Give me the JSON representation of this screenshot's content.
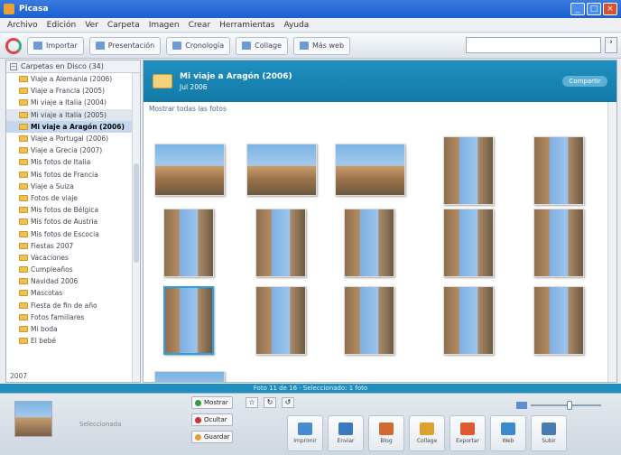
{
  "window": {
    "title": "Picasa"
  },
  "menu": [
    "Archivo",
    "Edición",
    "Ver",
    "Carpeta",
    "Imagen",
    "Crear",
    "Herramientas",
    "Ayuda"
  ],
  "toolbar": {
    "buttons": [
      {
        "label": "Importar",
        "icon": "import-icon"
      },
      {
        "label": "Presentación",
        "icon": "slideshow-icon"
      },
      {
        "label": "Cronología",
        "icon": "timeline-icon"
      },
      {
        "label": "Collage",
        "icon": "collage-icon"
      },
      {
        "label": "Más web",
        "icon": "web-icon"
      }
    ],
    "search_placeholder": "",
    "search_go": "›"
  },
  "sidebar": {
    "header": "Carpetas en Disco (34)",
    "items": [
      "Viaje a Alemania (2006)",
      "Viaje a Francia (2005)",
      "Mi viaje a Italia (2004)",
      "Mi viaje a Italia (2005)",
      "Mi viaje a Aragón (2006)",
      "Viaje a Portugal (2006)",
      "Viaje a Grecia (2007)",
      "Mis fotos de Italia",
      "Mis fotos de Francia",
      "Viaje a Suiza",
      "Fotos de viaje",
      "Mis fotos de Bélgica",
      "Mis fotos de Austria",
      "Mis fotos de Escocia",
      "Fiestas 2007",
      "Vacaciones",
      "Cumpleaños",
      "Navidad 2006",
      "Mascotas",
      "Fiesta de fin de año",
      "Fotos familiares",
      "Mi boda",
      "El bebé"
    ],
    "selected_index": 4,
    "footer": "2007"
  },
  "album": {
    "title": "Mi viaje a Aragón (2006)",
    "date": "Jul 2006",
    "header_button": "Compartir",
    "filter_text": "Mostrar todas las fotos",
    "photos": [
      {
        "name": "photo-01",
        "orient": "wide"
      },
      {
        "name": "photo-02",
        "orient": "wide"
      },
      {
        "name": "photo-03",
        "orient": "wide"
      },
      {
        "name": "photo-04",
        "orient": "tall"
      },
      {
        "name": "photo-05",
        "orient": "tall"
      },
      {
        "name": "photo-06",
        "orient": "tall"
      },
      {
        "name": "photo-07",
        "orient": "tall"
      },
      {
        "name": "photo-08",
        "orient": "tall"
      },
      {
        "name": "photo-09",
        "orient": "tall"
      },
      {
        "name": "photo-10",
        "orient": "tall"
      },
      {
        "name": "photo-11",
        "orient": "tall"
      },
      {
        "name": "photo-12",
        "orient": "tall"
      },
      {
        "name": "photo-13",
        "orient": "tall"
      },
      {
        "name": "photo-14",
        "orient": "tall"
      },
      {
        "name": "photo-15",
        "orient": "tall"
      },
      {
        "name": "photo-16",
        "orient": "wide"
      }
    ],
    "selected_photo": 10
  },
  "status_text": "Foto 11 de 16 · Seleccionado: 1 foto",
  "tray": {
    "caption": "Seleccionada",
    "buttons": [
      "Mostrar",
      "Ocultar",
      "Guardar"
    ],
    "tools": [
      "☆",
      "↻",
      "↺"
    ],
    "actions": [
      {
        "label": "Imprimir",
        "color": "#4a8bd0"
      },
      {
        "label": "Enviar",
        "color": "#3a78c0"
      },
      {
        "label": "Blog",
        "color": "#d06a30"
      },
      {
        "label": "Collage",
        "color": "#e0a030"
      },
      {
        "label": "Exportar",
        "color": "#e05a30"
      },
      {
        "label": "Web",
        "color": "#3a8ad0"
      },
      {
        "label": "Subir",
        "color": "#4a7ab0"
      }
    ],
    "zoom_level": 0.55
  }
}
